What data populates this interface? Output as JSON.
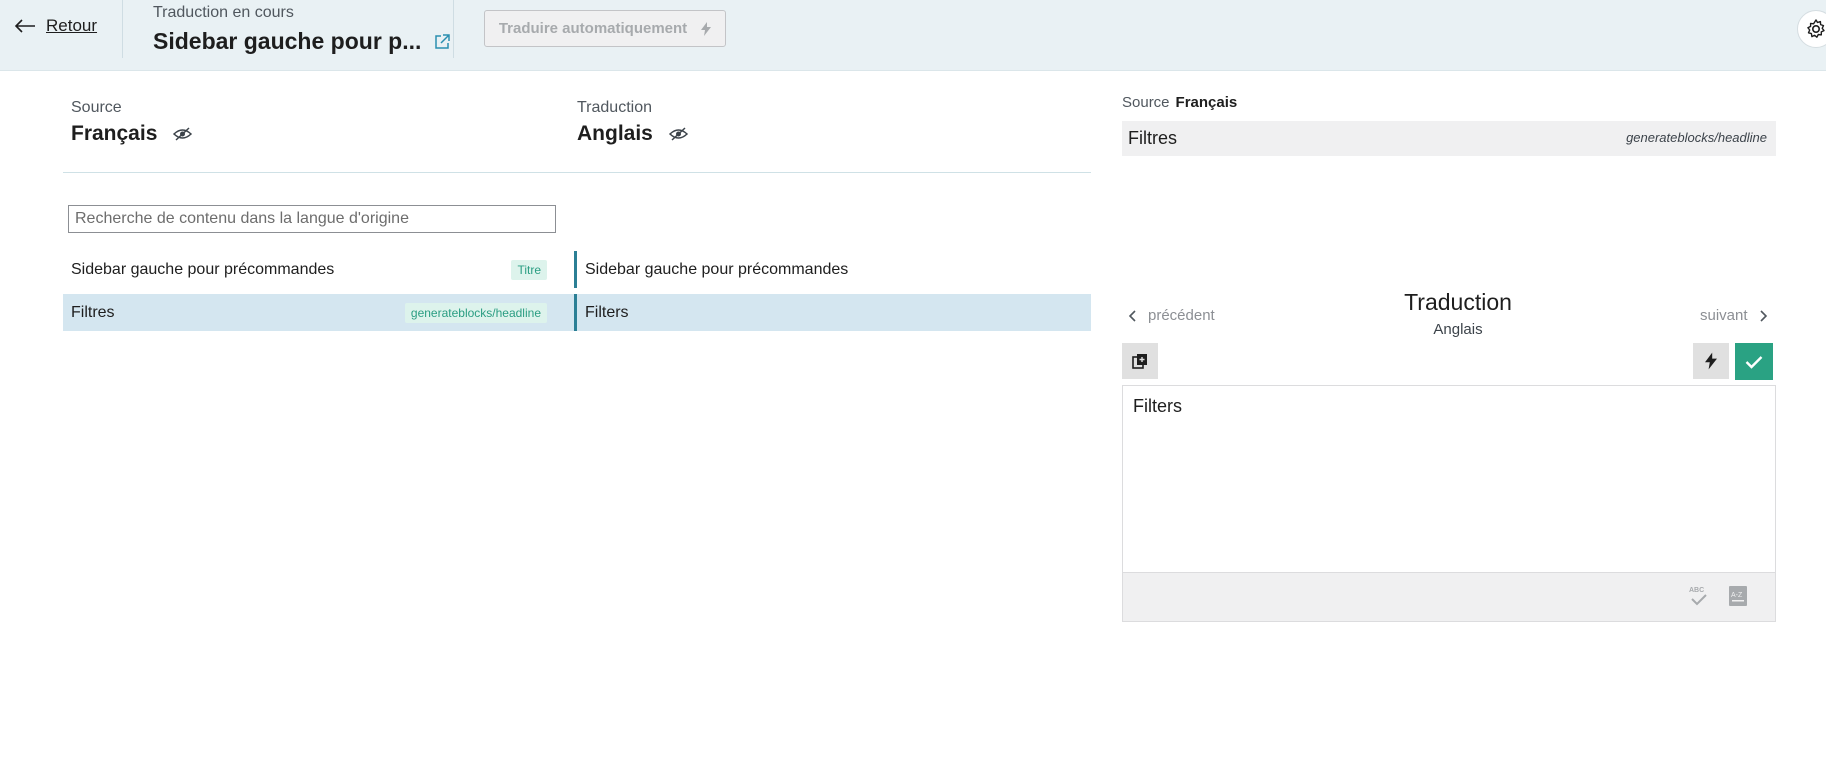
{
  "header": {
    "back_label": "Retour",
    "status": "Traduction en cours",
    "title": "Sidebar gauche pour p...",
    "auto_translate_label": "Traduire automatiquement"
  },
  "columns": {
    "source_label": "Source",
    "source_language": "Français",
    "target_label": "Traduction",
    "target_language": "Anglais"
  },
  "search": {
    "placeholder": "Recherche de contenu dans la langue d'origine"
  },
  "rows": [
    {
      "source": "Sidebar gauche pour précommandes",
      "tag": "Titre",
      "target": "Sidebar gauche pour précommandes",
      "selected": false
    },
    {
      "source": "Filtres",
      "tag": "generateblocks/headline",
      "target": "Filters",
      "selected": true
    }
  ],
  "panel": {
    "source_label": "Source",
    "source_language": "Français",
    "source_text": "Filtres",
    "source_block": "generateblocks/headline",
    "prev_label": "précédent",
    "next_label": "suivant",
    "translation_title": "Traduction",
    "translation_language": "Anglais",
    "translation_text": "Filters"
  },
  "colors": {
    "header_bg": "#e9f1f4",
    "accent": "#2b7f95",
    "save_button": "#2aa283",
    "selected_row": "#d4e6f0",
    "tag_bg": "#ddf3ec",
    "tag_text": "#2a9d82"
  },
  "icons": [
    "arrow-left-icon",
    "external-link-icon",
    "bolt-icon",
    "gear-icon",
    "eye-slash-icon",
    "chevron-left-icon",
    "chevron-right-icon",
    "copy-icon",
    "check-icon",
    "spellcheck-icon",
    "glossary-icon"
  ]
}
